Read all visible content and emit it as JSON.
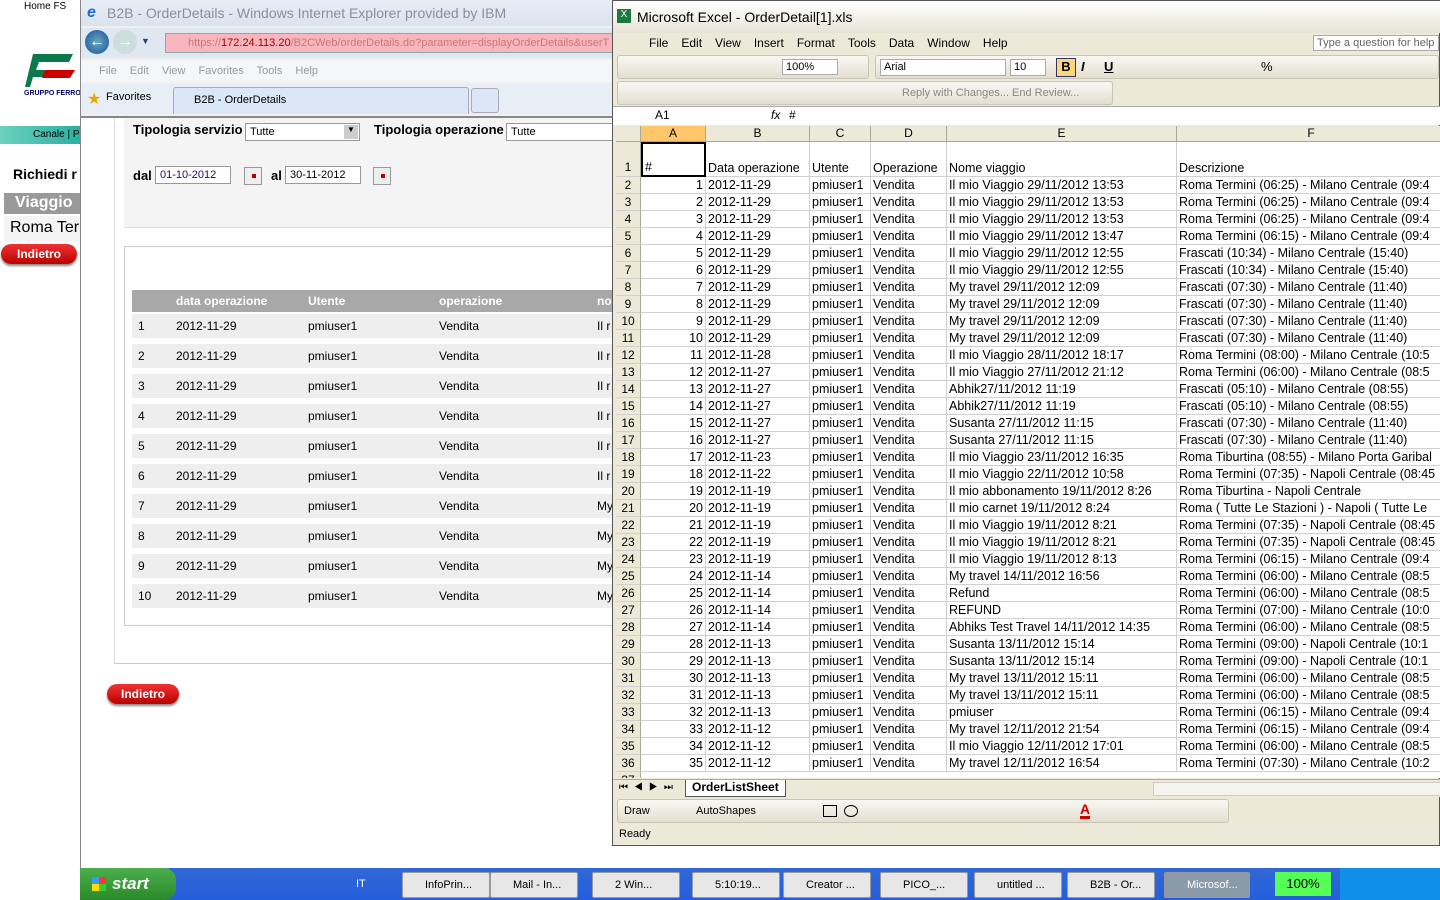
{
  "fs_page": {
    "home": "Home FS",
    "logo_text": "GRUPPO FERROVIE",
    "canale": "Canale | P",
    "richiedi": "Richiedi r",
    "viaggio": "Viaggio",
    "roma": "Roma Ter",
    "indietro": "Indietro"
  },
  "ie": {
    "title": "B2B - OrderDetails - Windows Internet Explorer provided by IBM",
    "url_prefix": "https://",
    "url_host": "172.24.113.20",
    "url_rest": "/B2CWeb/orderDetails.do?parameter=displayOrderDetails&userT",
    "menu": [
      "File",
      "Edit",
      "View",
      "Favorites",
      "Tools",
      "Help"
    ],
    "favorites": "Favorites",
    "tab": "B2B - OrderDetails",
    "filters": {
      "servizio_label": "Tipologia servizio",
      "servizio_value": "Tutte",
      "operazione_label": "Tipologia operazione",
      "operazione_value": "Tutte",
      "dal_label": "dal",
      "dal_value": "01-10-2012",
      "al_label": "al",
      "al_value": "30-11-2012"
    },
    "table": {
      "headers": [
        "data operazione",
        "Utente",
        "operazione",
        "no"
      ],
      "rows": [
        [
          "1",
          "2012-11-29",
          "pmiuser1",
          "Vendita",
          "Il r"
        ],
        [
          "2",
          "2012-11-29",
          "pmiuser1",
          "Vendita",
          "Il r"
        ],
        [
          "3",
          "2012-11-29",
          "pmiuser1",
          "Vendita",
          "Il r"
        ],
        [
          "4",
          "2012-11-29",
          "pmiuser1",
          "Vendita",
          "Il r"
        ],
        [
          "5",
          "2012-11-29",
          "pmiuser1",
          "Vendita",
          "Il r"
        ],
        [
          "6",
          "2012-11-29",
          "pmiuser1",
          "Vendita",
          "Il r"
        ],
        [
          "7",
          "2012-11-29",
          "pmiuser1",
          "Vendita",
          "My"
        ],
        [
          "8",
          "2012-11-29",
          "pmiuser1",
          "Vendita",
          "My"
        ],
        [
          "9",
          "2012-11-29",
          "pmiuser1",
          "Vendita",
          "My"
        ],
        [
          "10",
          "2012-11-29",
          "pmiuser1",
          "Vendita",
          "My"
        ]
      ]
    },
    "back_button": "Indietro"
  },
  "excel": {
    "title": "Microsoft Excel - OrderDetail[1].xls",
    "menu": [
      "File",
      "Edit",
      "View",
      "Insert",
      "Format",
      "Tools",
      "Data",
      "Window",
      "Help"
    ],
    "help_placeholder": "Type a question for help",
    "zoom": "100%",
    "font": "Arial",
    "font_size": "10",
    "review": "Reply with Changes...  End Review...",
    "name_box": "A1",
    "formula": "#",
    "columns": [
      "A",
      "B",
      "C",
      "D",
      "E",
      "F"
    ],
    "header_row": [
      "#",
      "Data operazione",
      "Utente",
      "Operazione",
      "Nome viaggio",
      "Descrizione"
    ],
    "rows": [
      [
        "1",
        "2012-11-29",
        "pmiuser1",
        "Vendita",
        "Il mio Viaggio 29/11/2012 13:53",
        "Roma Termini (06:25) - Milano Centrale (09:4"
      ],
      [
        "2",
        "2012-11-29",
        "pmiuser1",
        "Vendita",
        "Il mio Viaggio 29/11/2012 13:53",
        "Roma Termini (06:25) - Milano Centrale (09:4"
      ],
      [
        "3",
        "2012-11-29",
        "pmiuser1",
        "Vendita",
        "Il mio Viaggio 29/11/2012 13:53",
        "Roma Termini (06:25) - Milano Centrale (09:4"
      ],
      [
        "4",
        "2012-11-29",
        "pmiuser1",
        "Vendita",
        "Il mio Viaggio 29/11/2012 13:47",
        "Roma Termini (06:15) - Milano Centrale (09:4"
      ],
      [
        "5",
        "2012-11-29",
        "pmiuser1",
        "Vendita",
        "Il mio Viaggio 29/11/2012 12:55",
        "Frascati (10:34) - Milano Centrale (15:40)"
      ],
      [
        "6",
        "2012-11-29",
        "pmiuser1",
        "Vendita",
        "Il mio Viaggio 29/11/2012 12:55",
        "Frascati (10:34) - Milano Centrale (15:40)"
      ],
      [
        "7",
        "2012-11-29",
        "pmiuser1",
        "Vendita",
        "My travel 29/11/2012 12:09",
        "Frascati (07:30) - Milano Centrale (11:40)"
      ],
      [
        "8",
        "2012-11-29",
        "pmiuser1",
        "Vendita",
        "My travel 29/11/2012 12:09",
        "Frascati (07:30) - Milano Centrale (11:40)"
      ],
      [
        "9",
        "2012-11-29",
        "pmiuser1",
        "Vendita",
        "My travel 29/11/2012 12:09",
        "Frascati (07:30) - Milano Centrale (11:40)"
      ],
      [
        "10",
        "2012-11-29",
        "pmiuser1",
        "Vendita",
        "My travel 29/11/2012 12:09",
        "Frascati (07:30) - Milano Centrale (11:40)"
      ],
      [
        "11",
        "2012-11-28",
        "pmiuser1",
        "Vendita",
        "Il mio Viaggio 28/11/2012 18:17",
        "Roma Termini (08:00) - Milano Centrale (10:5"
      ],
      [
        "12",
        "2012-11-27",
        "pmiuser1",
        "Vendita",
        "Il mio Viaggio 27/11/2012 21:12",
        "Roma Termini (06:00) - Milano Centrale (08:5"
      ],
      [
        "13",
        "2012-11-27",
        "pmiuser1",
        "Vendita",
        "Abhik27/11/2012 11:19",
        "Frascati (05:10) - Milano Centrale (08:55)"
      ],
      [
        "14",
        "2012-11-27",
        "pmiuser1",
        "Vendita",
        "Abhik27/11/2012 11:19",
        "Frascati (05:10) - Milano Centrale (08:55)"
      ],
      [
        "15",
        "2012-11-27",
        "pmiuser1",
        "Vendita",
        "Susanta  27/11/2012 11:15",
        "Frascati (07:30) - Milano Centrale (11:40)"
      ],
      [
        "16",
        "2012-11-27",
        "pmiuser1",
        "Vendita",
        "Susanta  27/11/2012 11:15",
        "Frascati (07:30) - Milano Centrale (11:40)"
      ],
      [
        "17",
        "2012-11-23",
        "pmiuser1",
        "Vendita",
        "Il mio Viaggio 23/11/2012 16:35",
        "Roma Tiburtina (08:55) - Milano Porta Garibal"
      ],
      [
        "18",
        "2012-11-22",
        "pmiuser1",
        "Vendita",
        "Il mio Viaggio 22/11/2012 10:58",
        "Roma Termini (07:35) - Napoli Centrale (08:45"
      ],
      [
        "19",
        "2012-11-19",
        "pmiuser1",
        "Vendita",
        "Il mio abbonamento 19/11/2012 8:26",
        "Roma Tiburtina - Napoli Centrale"
      ],
      [
        "20",
        "2012-11-19",
        "pmiuser1",
        "Vendita",
        "Il mio carnet 19/11/2012 8:24",
        "Roma ( Tutte Le Stazioni ) - Napoli ( Tutte Le"
      ],
      [
        "21",
        "2012-11-19",
        "pmiuser1",
        "Vendita",
        "Il mio Viaggio 19/11/2012 8:21",
        "Roma Termini (07:35) - Napoli Centrale (08:45"
      ],
      [
        "22",
        "2012-11-19",
        "pmiuser1",
        "Vendita",
        "Il mio Viaggio 19/11/2012 8:21",
        "Roma Termini (07:35) - Napoli Centrale (08:45"
      ],
      [
        "23",
        "2012-11-19",
        "pmiuser1",
        "Vendita",
        "Il mio Viaggio 19/11/2012 8:13",
        "Roma Termini (06:15) - Milano Centrale (09:4"
      ],
      [
        "24",
        "2012-11-14",
        "pmiuser1",
        "Vendita",
        "My travel 14/11/2012 16:56",
        "Roma Termini (06:00) - Milano Centrale (08:5"
      ],
      [
        "25",
        "2012-11-14",
        "pmiuser1",
        "Vendita",
        "Refund",
        "Roma Termini (06:00) - Milano Centrale (08:5"
      ],
      [
        "26",
        "2012-11-14",
        "pmiuser1",
        "Vendita",
        "REFUND",
        "Roma Termini (07:00) - Milano Centrale (10:0"
      ],
      [
        "27",
        "2012-11-14",
        "pmiuser1",
        "Vendita",
        "Abhiks Test Travel 14/11/2012 14:35",
        "Roma Termini (06:00) - Milano Centrale (08:5"
      ],
      [
        "28",
        "2012-11-13",
        "pmiuser1",
        "Vendita",
        "Susanta 13/11/2012 15:14",
        "Roma Termini (09:00) - Napoli Centrale (10:1"
      ],
      [
        "29",
        "2012-11-13",
        "pmiuser1",
        "Vendita",
        "Susanta 13/11/2012 15:14",
        "Roma Termini (09:00) - Napoli Centrale (10:1"
      ],
      [
        "30",
        "2012-11-13",
        "pmiuser1",
        "Vendita",
        "My travel 13/11/2012 15:11",
        "Roma Termini (06:00) - Milano Centrale (08:5"
      ],
      [
        "31",
        "2012-11-13",
        "pmiuser1",
        "Vendita",
        "My travel 13/11/2012 15:11",
        "Roma Termini (06:00) - Milano Centrale (08:5"
      ],
      [
        "32",
        "2012-11-13",
        "pmiuser1",
        "Vendita",
        "pmiuser",
        "Roma Termini (06:15) - Milano Centrale (09:4"
      ],
      [
        "33",
        "2012-11-12",
        "pmiuser1",
        "Vendita",
        "My travel 12/11/2012 21:54",
        "Roma Termini (06:15) - Milano Centrale (09:4"
      ],
      [
        "34",
        "2012-11-12",
        "pmiuser1",
        "Vendita",
        "Il mio Viaggio 12/11/2012 17:01",
        "Roma Termini (06:00) - Milano Centrale (08:5"
      ],
      [
        "35",
        "2012-11-12",
        "pmiuser1",
        "Vendita",
        "My travel 12/11/2012 16:54",
        "Roma Termini (07:30) - Milano Centrale (10:2"
      ]
    ],
    "sheet_tab": "OrderListSheet",
    "draw": "Draw",
    "autoshapes": "AutoShapes",
    "status": "Ready"
  },
  "taskbar": {
    "start": "start",
    "lang": "IT",
    "items": [
      "InfoPrin...",
      "Mail - In...",
      "2 Win...",
      "5:10:19...",
      "Creator ...",
      "PICO_...",
      "untitled ...",
      "B2B - Or...",
      "Microsof..."
    ],
    "battery": "100%"
  }
}
